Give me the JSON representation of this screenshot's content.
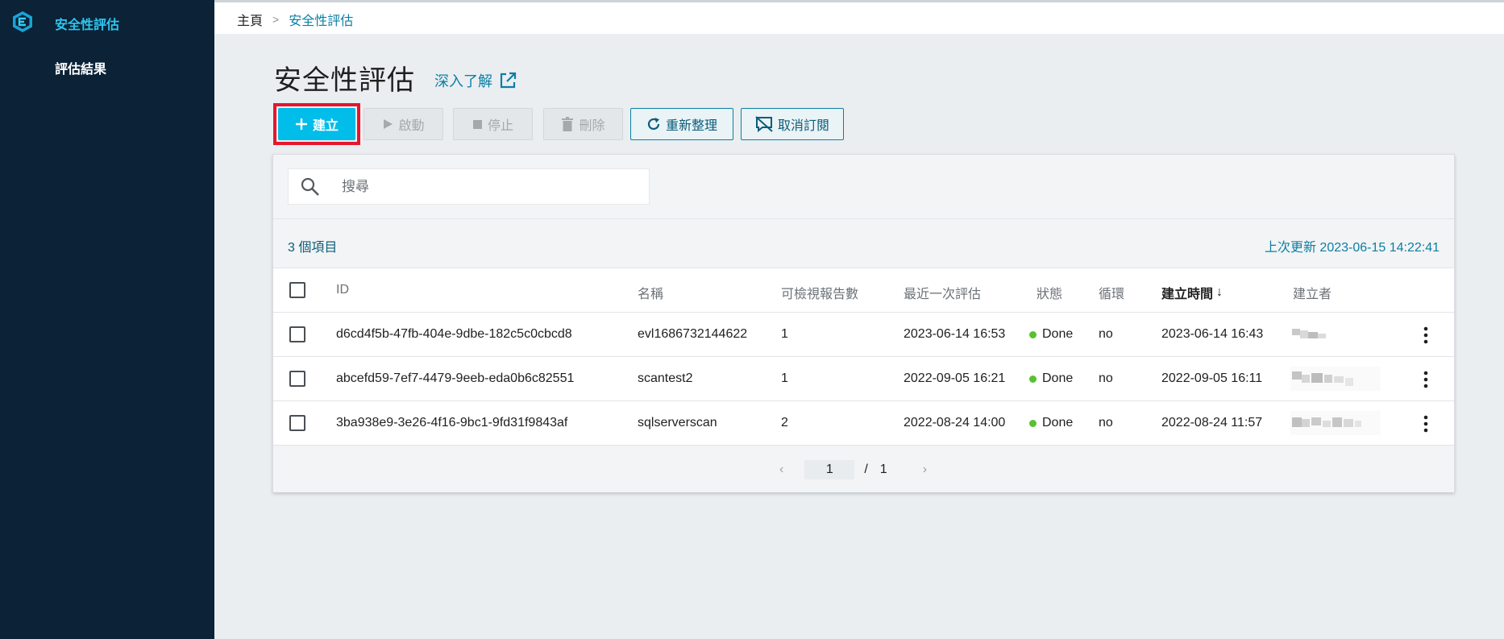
{
  "sidebar": {
    "app_title": "安全性評估",
    "items": [
      {
        "label": "評估結果"
      }
    ]
  },
  "breadcrumb": {
    "home": "主頁",
    "separator": ">",
    "current": "安全性評估"
  },
  "page": {
    "title": "安全性評估",
    "learn_more": "深入了解"
  },
  "toolbar": {
    "create": "建立",
    "start": "啟動",
    "stop": "停止",
    "delete": "刪除",
    "refresh": "重新整理",
    "unsubscribe": "取消訂閱"
  },
  "search": {
    "placeholder": "搜尋"
  },
  "summary": {
    "item_count": "3 個項目",
    "last_updated": "上次更新 2023-06-15 14:22:41"
  },
  "table": {
    "columns": {
      "id": "ID",
      "name": "名稱",
      "reports": "可檢視報告數",
      "last_eval": "最近一次評估",
      "status": "狀態",
      "loop": "循環",
      "created_at": "建立時間",
      "creator": "建立者"
    },
    "sort_indicator": "↓",
    "rows": [
      {
        "id": "d6cd4f5b-47fb-404e-9dbe-182c5c0cbcd8",
        "name": "evl1686732144622",
        "reports": "1",
        "last_eval": "2023-06-14 16:53",
        "status": "Done",
        "loop": "no",
        "created_at": "2023-06-14 16:43"
      },
      {
        "id": "abcefd59-7ef7-4479-9eeb-eda0b6c82551",
        "name": "scantest2",
        "reports": "1",
        "last_eval": "2022-09-05 16:21",
        "status": "Done",
        "loop": "no",
        "created_at": "2022-09-05 16:11"
      },
      {
        "id": "3ba938e9-3e26-4f16-9bc1-9fd31f9843af",
        "name": "sqlserverscan",
        "reports": "2",
        "last_eval": "2022-08-24 14:00",
        "status": "Done",
        "loop": "no",
        "created_at": "2022-08-24 11:57"
      }
    ]
  },
  "pagination": {
    "current": "1",
    "separator": "/",
    "total": "1"
  },
  "colors": {
    "accent": "#00bde9",
    "link": "#0a7fa5",
    "sidebar_bg": "#0b2237",
    "status_done": "#58c130",
    "highlight": "#e6162d"
  }
}
